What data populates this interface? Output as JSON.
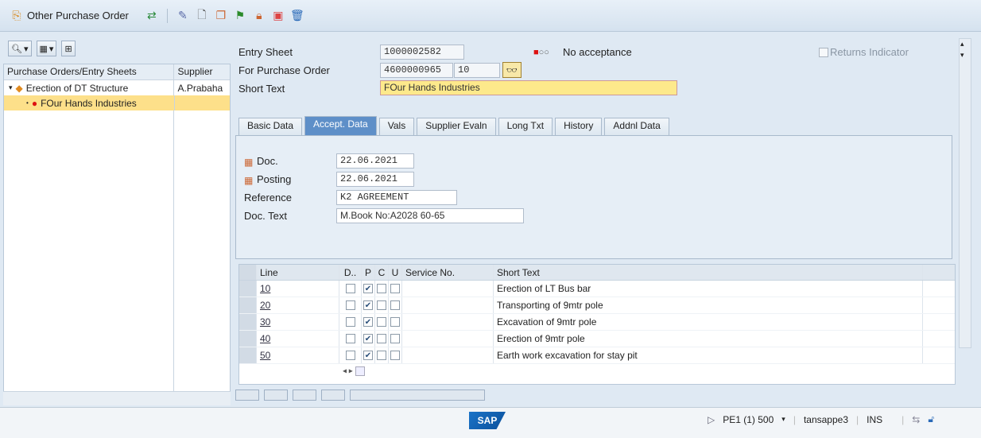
{
  "toolbar": {
    "other_po_label": "Other Purchase Order",
    "icons": [
      "tree-toggle-icon",
      "edit-icon",
      "create-icon",
      "copy-icon",
      "flag-icon",
      "lock-icon",
      "print-icon",
      "delete-icon"
    ]
  },
  "left_panel": {
    "col_po": "Purchase Orders/Entry Sheets",
    "col_supplier": "Supplier",
    "rows": [
      {
        "label": "Erection of DT Structure",
        "supplier": "A.Prabaha"
      },
      {
        "label": "FOur Hands Industries",
        "supplier": ""
      }
    ]
  },
  "header": {
    "entry_sheet_label": "Entry Sheet",
    "entry_sheet_value": "1000002582",
    "po_label": "For Purchase Order",
    "po_value": "4600000965",
    "po_item": "10",
    "short_text_label": "Short Text",
    "short_text_value": "FOur Hands Industries",
    "acceptance_status": "No acceptance",
    "returns_indicator": "Returns Indicator"
  },
  "tabs": [
    "Basic Data",
    "Accept. Data",
    "Vals",
    "Supplier Evaln",
    "Long Txt",
    "History",
    "Addnl Data"
  ],
  "active_tab": "Accept. Data",
  "accept_data": {
    "doc_label": "Doc.",
    "doc_date": "22.06.2021",
    "posting_label": "Posting",
    "posting_date": "22.06.2021",
    "reference_label": "Reference",
    "reference_value": "K2 AGREEMENT",
    "doc_text_label": "Doc. Text",
    "doc_text_value": "M.Book No:A2028 60-65"
  },
  "grid": {
    "headers": {
      "line": "Line",
      "d": "D..",
      "p": "P",
      "c": "C",
      "u": "U",
      "service": "Service No.",
      "short_text": "Short Text"
    },
    "rows": [
      {
        "line": "10",
        "p": true,
        "text": "Erection of LT Bus bar"
      },
      {
        "line": "20",
        "p": true,
        "text": "Transporting of 9mtr pole"
      },
      {
        "line": "30",
        "p": true,
        "text": "Excavation of 9mtr pole"
      },
      {
        "line": "40",
        "p": true,
        "text": "Erection of 9mtr pole"
      },
      {
        "line": "50",
        "p": true,
        "text": "Earth work excavation for stay pit"
      }
    ]
  },
  "status": {
    "system": "PE1 (1) 500",
    "server": "tansappe3",
    "mode": "INS",
    "logo": "SAP"
  }
}
